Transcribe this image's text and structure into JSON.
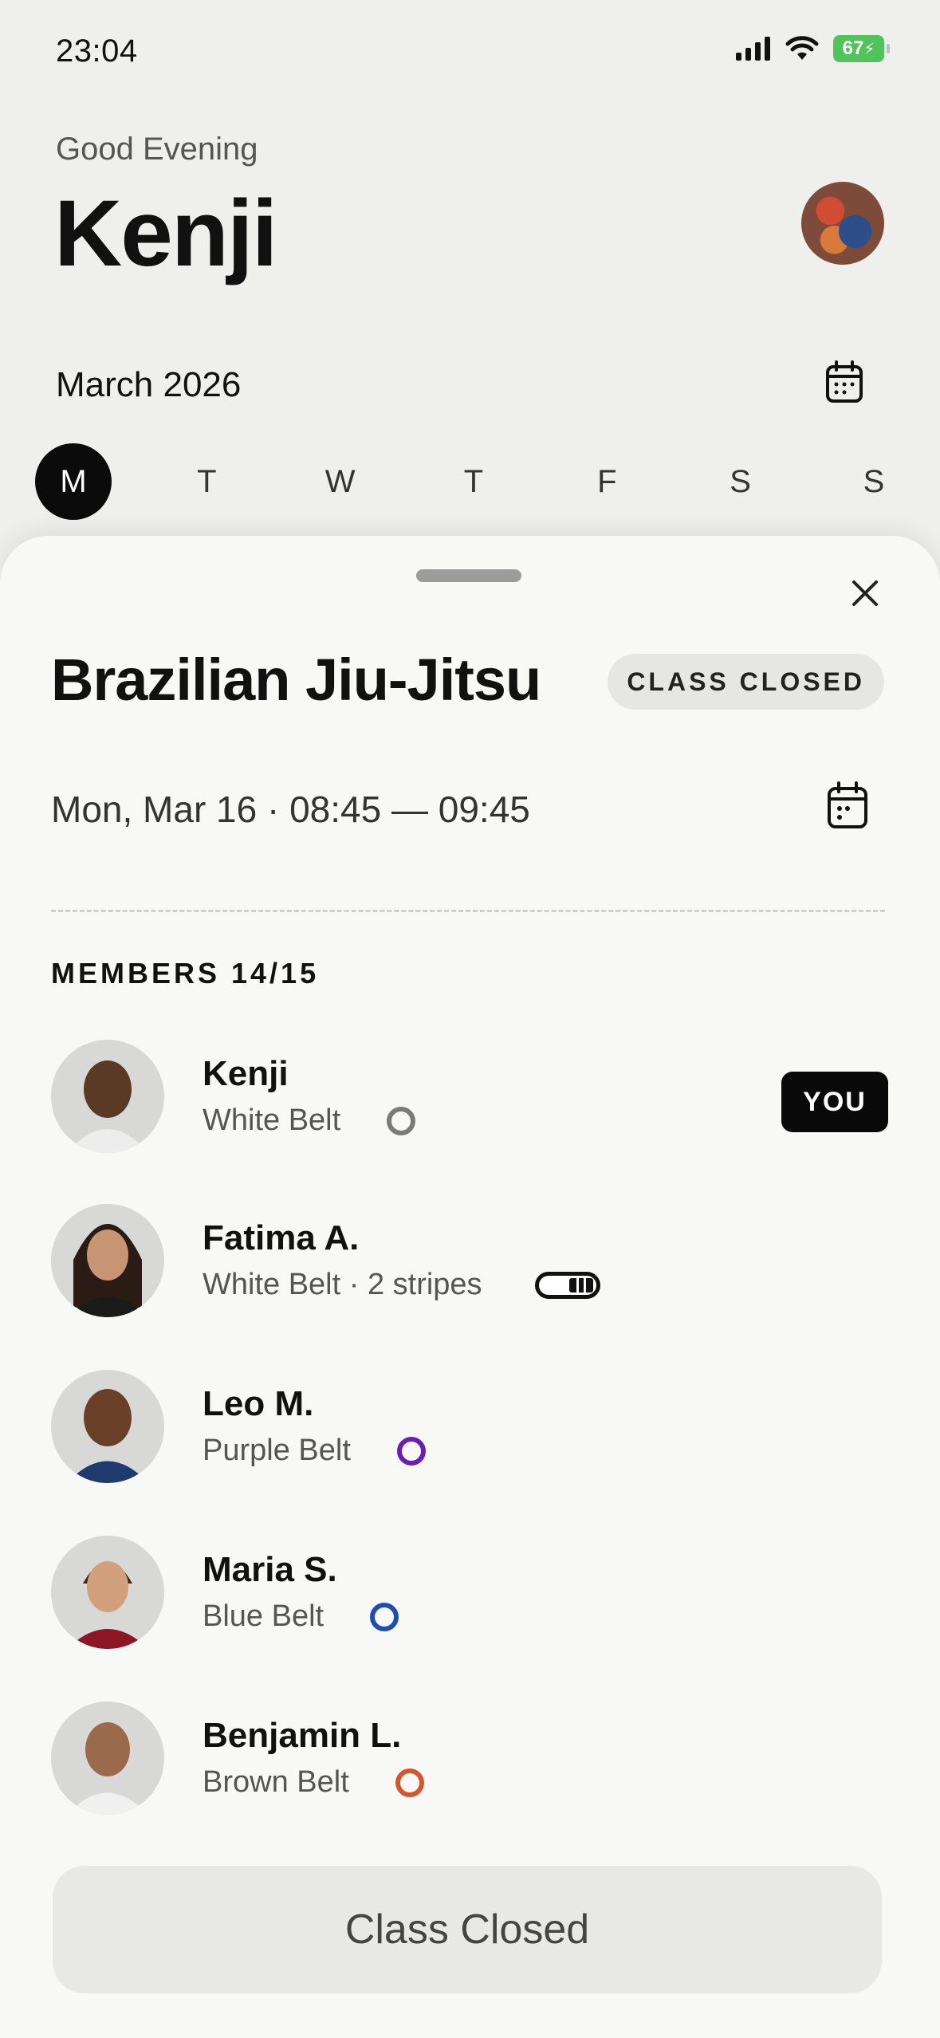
{
  "status_bar": {
    "time": "23:04",
    "battery": "67"
  },
  "header": {
    "greeting": "Good Evening",
    "name": "Kenji",
    "month": "March 2026"
  },
  "week_days": [
    "M",
    "T",
    "W",
    "T",
    "F",
    "S",
    "S"
  ],
  "sheet": {
    "class_title": "Brazilian Jiu-Jitsu",
    "status_chip": "CLASS CLOSED",
    "datetime": "Mon, Mar 16 · 08:45 — 09:45",
    "members_heading": "MEMBERS 14/15",
    "members": [
      {
        "name": "Kenji",
        "belt": "White Belt",
        "badge": "YOU",
        "belt_color": "#7a7a7a"
      },
      {
        "name": "Fatima A.",
        "belt": "White Belt · 2 stripes",
        "stripes": 2
      },
      {
        "name": "Leo M.",
        "belt": "Purple Belt",
        "belt_color": "#6a1fb0"
      },
      {
        "name": "Maria S.",
        "belt": "Blue Belt",
        "belt_color": "#1e4fb0"
      },
      {
        "name": "Benjamin L.",
        "belt": "Brown Belt",
        "belt_color": "#d4562a"
      }
    ],
    "button_label": "Class Closed"
  },
  "colors": {
    "background": "#efefee",
    "sheet": "#f8f8f7",
    "accent": "#0b0b0b"
  }
}
